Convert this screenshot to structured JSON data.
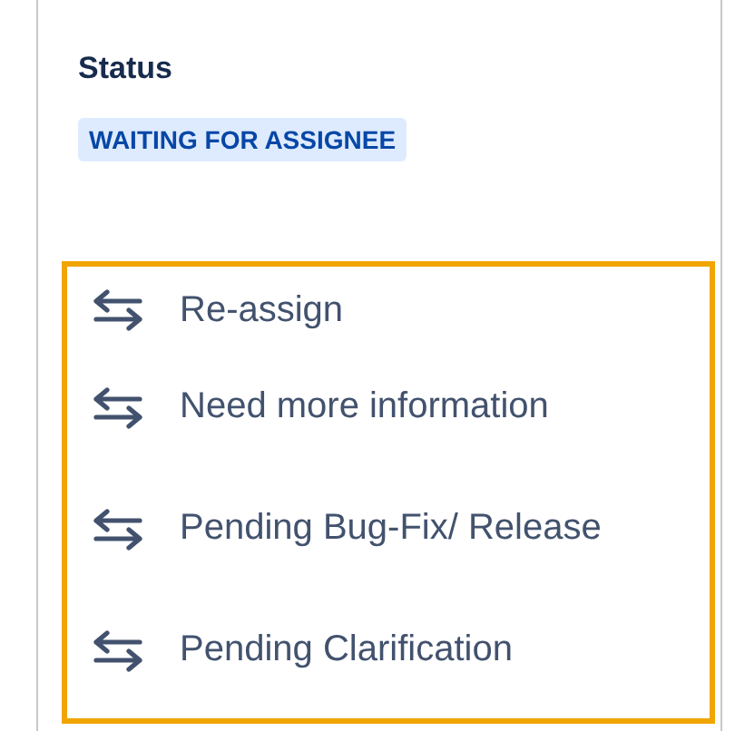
{
  "status": {
    "label": "Status",
    "value": "WAITING FOR ASSIGNEE"
  },
  "transitions": [
    {
      "label": "Re-assign"
    },
    {
      "label": "Need more information"
    },
    {
      "label": "Pending Bug-Fix/ Release"
    },
    {
      "label": "Pending Clarification"
    }
  ]
}
